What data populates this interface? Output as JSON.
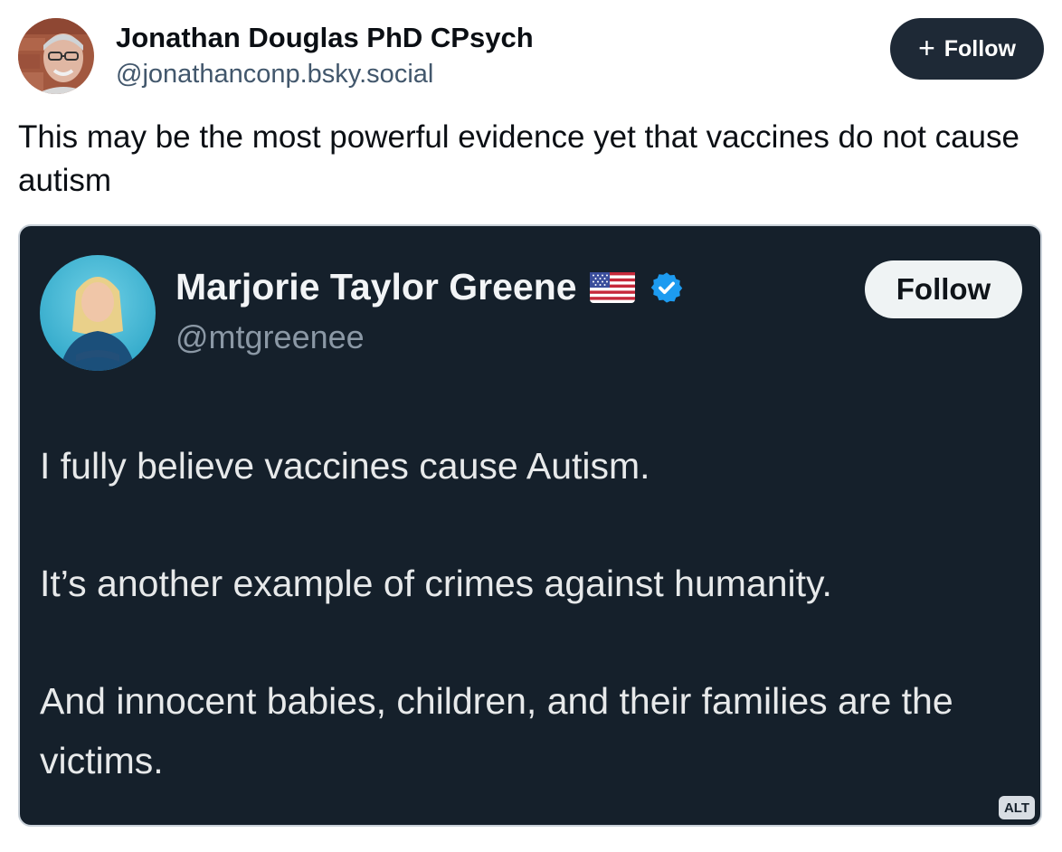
{
  "post": {
    "author_name": "Jonathan Douglas PhD CPsych",
    "author_handle": "@jonathanconp.bsky.social",
    "follow_label": "Follow",
    "text": "This may be the most powerful evidence yet that vaccines do not cause autism"
  },
  "embed": {
    "name": "Marjorie Taylor Greene",
    "handle": "@mtgreenee",
    "follow_label": "Follow",
    "paragraphs": [
      "I fully believe vaccines cause Autism.",
      "It’s another example of crimes against humanity.",
      "And innocent babies, children, and their families are the victims."
    ],
    "alt_badge": "ALT",
    "flag_icon": "us-flag-icon",
    "verified_icon": "verified-badge-icon"
  },
  "colors": {
    "follow_button_bg": "#1e2936",
    "embed_bg": "#15202b",
    "verified_blue": "#1d9bf0",
    "handle_gray": "#42576c"
  }
}
